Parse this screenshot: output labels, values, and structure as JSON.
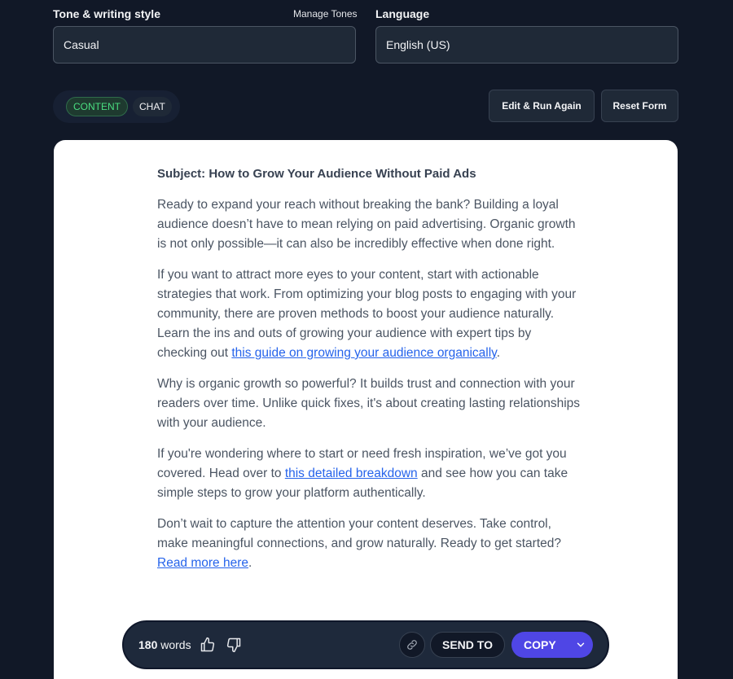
{
  "tone": {
    "label": "Tone & writing style",
    "manage_label": "Manage Tones",
    "value": "Casual"
  },
  "language": {
    "label": "Language",
    "value": "English (US)"
  },
  "mode_toggle": {
    "content_label": "CONTENT",
    "chat_label": "CHAT",
    "active": "content"
  },
  "actions": {
    "edit_run_label": "Edit & Run Again",
    "reset_label": "Reset Form"
  },
  "article": {
    "subject": "Subject: How to Grow Your Audience Without Paid Ads",
    "p1": "Ready to expand your reach without breaking the bank? Building a loyal audience doesn’t have to mean relying on paid advertising. Organic growth is not only possible—it can also be incredibly effective when done right.",
    "p2_before": "If you want to attract more eyes to your content, start with actionable strategies that work. From optimizing your blog posts to engaging with your community, there are proven methods to boost your audience naturally. Learn the ins and outs of growing your audience with expert tips by checking out ",
    "p2_link": "this guide on growing your audience organically",
    "p2_after": ".",
    "p3": "Why is organic growth so powerful? It builds trust and connection with your readers over time. Unlike quick fixes, it's about creating lasting relationships with your audience.",
    "p4_before": "If you're wondering where to start or need fresh inspiration, we’ve got you covered. Head over to ",
    "p4_link": "this detailed breakdown",
    "p4_after": " and see how you can take simple steps to grow your platform authentically.",
    "p5_before": "Don’t wait to capture the attention your content deserves. Take control, make meaningful connections, and grow naturally. Ready to get started? ",
    "p5_link": "Read more here",
    "p5_after": "."
  },
  "bottom_bar": {
    "word_count": "180",
    "words_label": "words",
    "send_label": "SEND TO",
    "copy_label": "COPY",
    "icons": [
      "thumbs-up-icon",
      "thumbs-down-icon",
      "link-icon",
      "chevron-down-icon"
    ]
  },
  "colors": {
    "background": "#111827",
    "accent": "#4f46e5",
    "active_pill": "#4ade80",
    "link": "#2563eb"
  }
}
